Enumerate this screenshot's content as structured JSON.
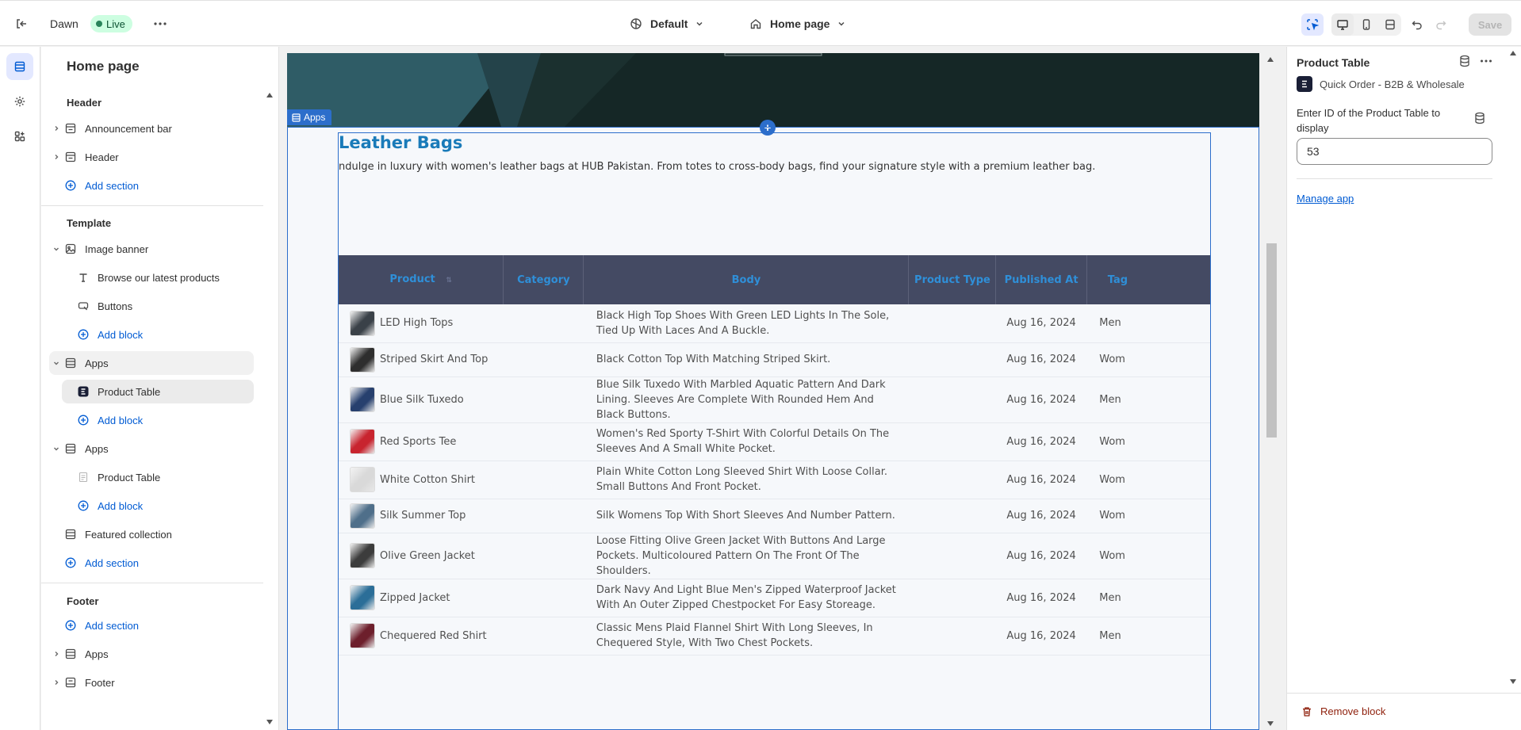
{
  "topbar": {
    "theme_name": "Dawn",
    "live_badge": "Live",
    "theme_selector": "Default",
    "page_selector": "Home page",
    "save_label": "Save"
  },
  "sidebar": {
    "title": "Home page",
    "groups": {
      "header": "Header",
      "template": "Template",
      "footer": "Footer"
    },
    "items": {
      "announcement_bar": "Announcement bar",
      "header": "Header",
      "add_section_1": "Add section",
      "image_banner": "Image banner",
      "browse_latest": "Browse our latest products",
      "buttons": "Buttons",
      "add_block_1": "Add block",
      "apps_1": "Apps",
      "product_table_1": "Product Table",
      "add_block_2": "Add block",
      "apps_2": "Apps",
      "product_table_2": "Product Table",
      "add_block_3": "Add block",
      "featured_collection": "Featured collection",
      "add_section_2": "Add section",
      "add_section_3": "Add section",
      "apps_3": "Apps",
      "footer": "Footer"
    }
  },
  "preview": {
    "apps_tag": "Apps",
    "block_title": "Leather Bags",
    "block_desc": "ndulge in luxury with women's leather bags at HUB Pakistan. From totes to cross-body bags, find your signature style with a premium leather bag.",
    "columns": [
      "Product",
      "Category",
      "Body",
      "Product Type",
      "Published At",
      "Tag"
    ],
    "rows": [
      {
        "product": "LED High Tops",
        "body": "Black High Top Shoes With Green LED Lights In The Sole, Tied Up With Laces And A Buckle.",
        "published": "Aug 16, 2024",
        "tags": "Men",
        "thumb_color": "#3a4148"
      },
      {
        "product": "Striped Skirt And Top",
        "body": "Black Cotton Top With Matching Striped Skirt.",
        "published": "Aug 16, 2024",
        "tags": "Wom",
        "thumb_color": "#2e2e2e"
      },
      {
        "product": "Blue Silk Tuxedo",
        "body": "Blue Silk Tuxedo With Marbled Aquatic Pattern And Dark Lining. Sleeves Are Complete With Rounded Hem And Black Buttons.",
        "published": "Aug 16, 2024",
        "tags": "Men",
        "thumb_color": "#27406e"
      },
      {
        "product": "Red Sports Tee",
        "body": "Women's Red Sporty T-Shirt With Colorful Details On The Sleeves And A Small White Pocket.",
        "published": "Aug 16, 2024",
        "tags": "Wom",
        "thumb_color": "#c8242f"
      },
      {
        "product": "White Cotton Shirt",
        "body": "Plain White Cotton Long Sleeved Shirt With Loose Collar. Small Buttons And Front Pocket.",
        "published": "Aug 16, 2024",
        "tags": "Wom",
        "thumb_color": "#d9d9d9"
      },
      {
        "product": "Silk Summer Top",
        "body": "Silk Womens Top With Short Sleeves And Number Pattern.",
        "published": "Aug 16, 2024",
        "tags": "Wom",
        "thumb_color": "#4f6f8a"
      },
      {
        "product": "Olive Green Jacket",
        "body": "Loose Fitting Olive Green Jacket With Buttons And Large Pockets. Multicoloured Pattern On The Front Of The Shoulders.",
        "published": "Aug 16, 2024",
        "tags": "Wom",
        "thumb_color": "#3c3c3c"
      },
      {
        "product": "Zipped Jacket",
        "body": "Dark Navy And Light Blue Men's Zipped Waterproof Jacket With An Outer Zipped Chestpocket For Easy Storeage.",
        "published": "Aug 16, 2024",
        "tags": "Men",
        "thumb_color": "#2b6e98"
      },
      {
        "product": "Chequered Red Shirt",
        "body": "Classic Mens Plaid Flannel Shirt With Long Sleeves, In Chequered Style, With Two Chest Pockets.",
        "published": "Aug 16, 2024",
        "tags": "Men",
        "thumb_color": "#6d1f2c"
      }
    ]
  },
  "panel": {
    "title": "Product Table",
    "app_name": "Quick Order - B2B & Wholesale",
    "field_label": "Enter ID of the Product Table to display",
    "field_value": "53",
    "manage_link": "Manage app",
    "remove_label": "Remove block"
  },
  "colors": {
    "accent": "#2c6ecb",
    "link": "#005bd3",
    "table_header_bg": "#444a63",
    "table_header_text": "#2f8fd8",
    "live_bg": "#cdfee1",
    "danger": "#8e1f0b"
  }
}
